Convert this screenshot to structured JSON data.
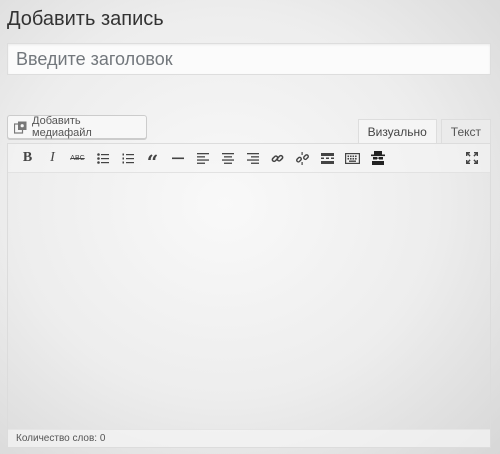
{
  "page": {
    "title": "Добавить запись"
  },
  "title_field": {
    "placeholder": "Введите заголовок",
    "value": ""
  },
  "media_button": {
    "label": "Добавить медиафайл",
    "icon": "media-icon"
  },
  "tabs": [
    {
      "label": "Визуально",
      "active": true
    },
    {
      "label": "Текст",
      "active": false
    }
  ],
  "toolbar": {
    "bold_label": "B",
    "italic_label": "I",
    "strikethrough_label": "ABC",
    "icons": [
      "bold-icon",
      "italic-icon",
      "strikethrough-icon",
      "bullet-list-icon",
      "numbered-list-icon",
      "blockquote-icon",
      "horizontal-rule-icon",
      "align-left-icon",
      "align-center-icon",
      "align-right-icon",
      "link-icon",
      "unlink-icon",
      "read-more-icon",
      "toolbar-toggle-icon",
      "incognito-icon",
      "fullscreen-icon"
    ]
  },
  "status_bar": {
    "word_count": "Количество слов: 0"
  }
}
